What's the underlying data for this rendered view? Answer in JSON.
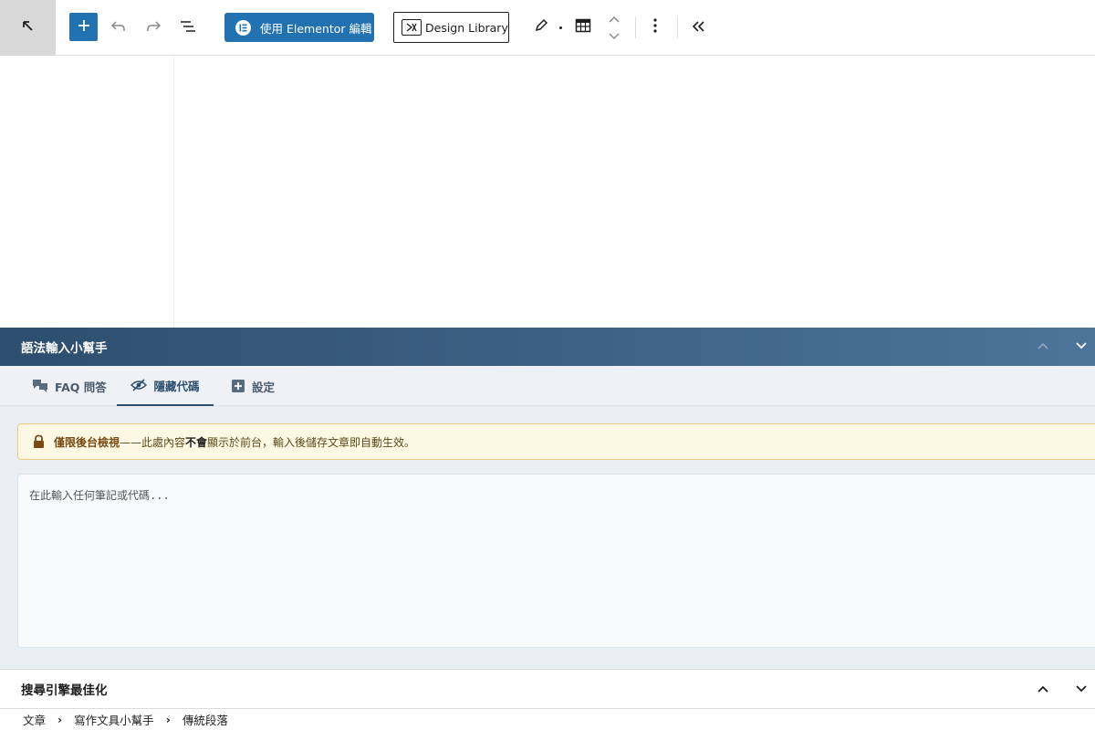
{
  "toolbar": {
    "wp_icon": "arrow-up-left-icon",
    "add_icon": "plus-icon",
    "undo_icon": "undo-icon",
    "redo_icon": "redo-icon",
    "outline_icon": "document-overview-icon",
    "elementor_label": "使用 Elementor 編輯",
    "design_library_label": "Design Library",
    "pen_icon": "pencil-icon",
    "table_icon": "table-icon",
    "more_icon": "more-vertical-icon",
    "collapse_icon": "chevrons-left-icon"
  },
  "metabox": {
    "title": "語法輸入小幫手",
    "tabs": [
      {
        "label": "FAQ 問答",
        "icon": "chat-bubbles-icon"
      },
      {
        "label": "隱藏代碼",
        "icon": "eye-slash-icon"
      },
      {
        "label": "設定",
        "icon": "settings-plus-icon"
      }
    ],
    "active_tab": "隱藏代碼",
    "notice": {
      "strong_prefix": "僅限後台檢視",
      "text_before": "——此處內容",
      "strong_mid": "不會",
      "text_after": "顯示於前台，輸入後儲存文章即自動生效。"
    },
    "code_placeholder": "在此輸入任何筆記或代碼..."
  },
  "seo": {
    "title": "搜尋引擎最佳化"
  },
  "breadcrumb": [
    "文章",
    "寫作文具小幫手",
    "傳統段落"
  ],
  "colors": {
    "accent": "#2271b1",
    "header_start": "#2d4e6e",
    "header_end": "#4d7499",
    "notice_bg": "#fdf8e3"
  }
}
